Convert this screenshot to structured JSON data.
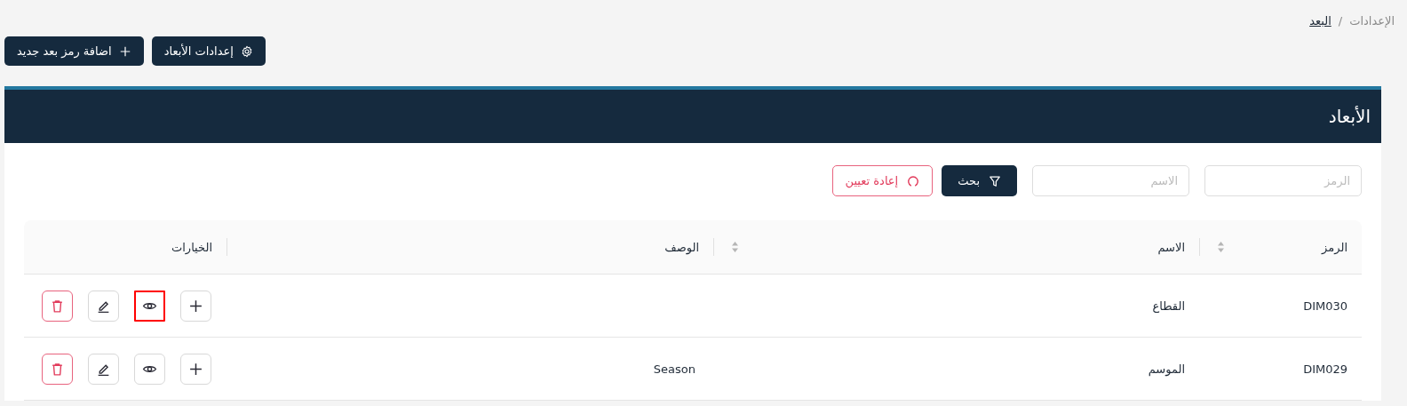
{
  "breadcrumb": [
    {
      "label": "الإعدادات",
      "current": false
    },
    {
      "label": "البعد",
      "current": true
    }
  ],
  "breadcrumb_separator": "/",
  "toolbar": [
    {
      "label": "إعدادات الأبعاد",
      "kind": "settings"
    },
    {
      "label": "اضافة رمز بعد جديد",
      "kind": "add"
    }
  ],
  "panel": {
    "title": "الأبعاد",
    "filters": [
      {
        "placeholder": "الرمز"
      },
      {
        "placeholder": "الاسم"
      }
    ],
    "search_button": "بحث",
    "reset_button": "إعادة تعيين",
    "table": {
      "columns": [
        {
          "label": "الرمز",
          "sortable": true
        },
        {
          "label": "الاسم",
          "sortable": true
        },
        {
          "label": "الوصف",
          "sortable": false
        },
        {
          "label": "الخيارات",
          "sortable": false
        }
      ],
      "rows": [
        {
          "code": "DIM030",
          "name": "القطاع",
          "actions": [
            {
              "kind": "add",
              "highlighted": false
            },
            {
              "kind": "view",
              "highlighted": true
            },
            {
              "kind": "edit",
              "highlighted": false
            },
            {
              "kind": "delete",
              "highlighted": false
            }
          ]
        },
        {
          "code": "DIM029",
          "name": "الموسم",
          "description": "Season",
          "actions": [
            {
              "kind": "add",
              "highlighted": false
            },
            {
              "kind": "view",
              "highlighted": false
            },
            {
              "kind": "edit",
              "highlighted": false
            },
            {
              "kind": "delete",
              "highlighted": false
            }
          ]
        }
      ]
    }
  }
}
